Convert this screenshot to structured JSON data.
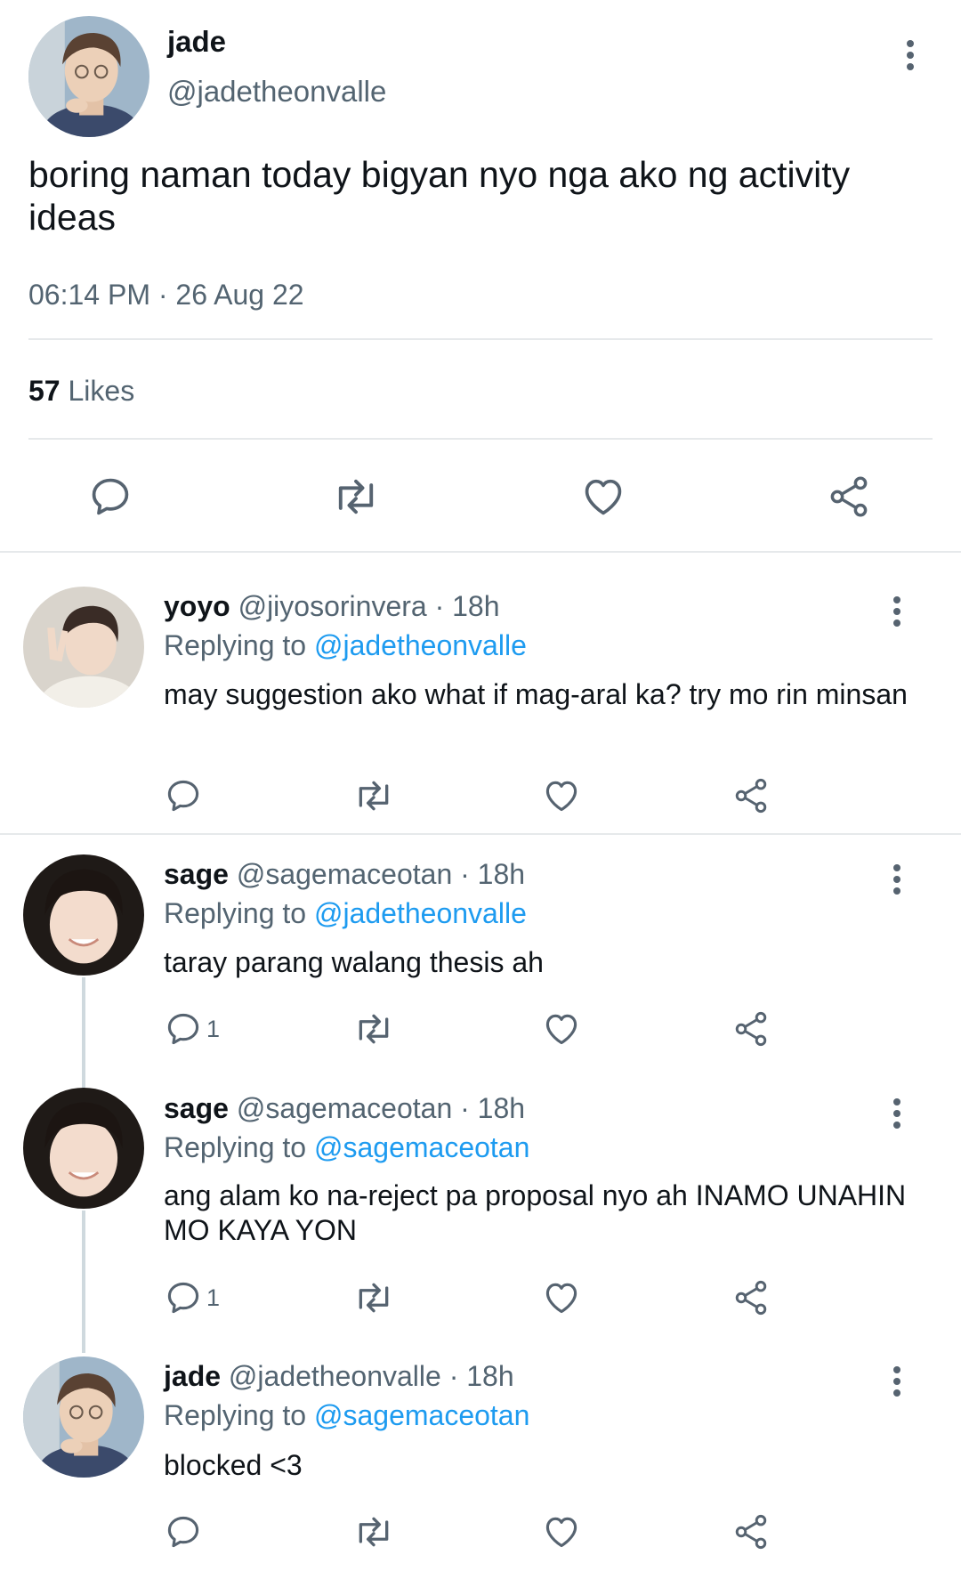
{
  "main_tweet": {
    "name": "jade",
    "handle": "@jadetheonvalle",
    "text": "boring naman today bigyan nyo nga ako ng activity ideas",
    "time": "06:14 PM · 26 Aug 22",
    "likes_count": "57",
    "likes_label": "Likes"
  },
  "replies": [
    {
      "name": "yoyo",
      "handle_time": " @jiyosorinvera · 18h",
      "replying_label": "Replying to ",
      "replying_to": "@jadetheonvalle",
      "text": "may suggestion ako what if mag-aral ka? try mo rin minsan",
      "reply_count": ""
    },
    {
      "name": "sage",
      "handle_time": "  @sagemaceotan · 18h",
      "replying_label": "Replying to ",
      "replying_to": "@jadetheonvalle",
      "text": "taray parang walang thesis ah",
      "reply_count": "1"
    },
    {
      "name": "sage",
      "handle_time": "  @sagemaceotan · 18h",
      "replying_label": "Replying to ",
      "replying_to": "@sagemaceotan",
      "text": "ang alam ko na-reject pa proposal nyo ah INAMO UNAHIN MO KAYA YON",
      "reply_count": "1"
    },
    {
      "name": "jade",
      "handle_time": " @jadetheonvalle · 18h",
      "replying_label": "Replying to ",
      "replying_to": "@sagemaceotan",
      "text": "blocked <3",
      "reply_count": ""
    }
  ],
  "icons": [
    "reply-icon",
    "retweet-icon",
    "like-icon",
    "share-icon",
    "more-icon"
  ],
  "colors": {
    "link": "#1d9bf0",
    "secondary": "#536471",
    "divider": "#e6e9eb"
  }
}
